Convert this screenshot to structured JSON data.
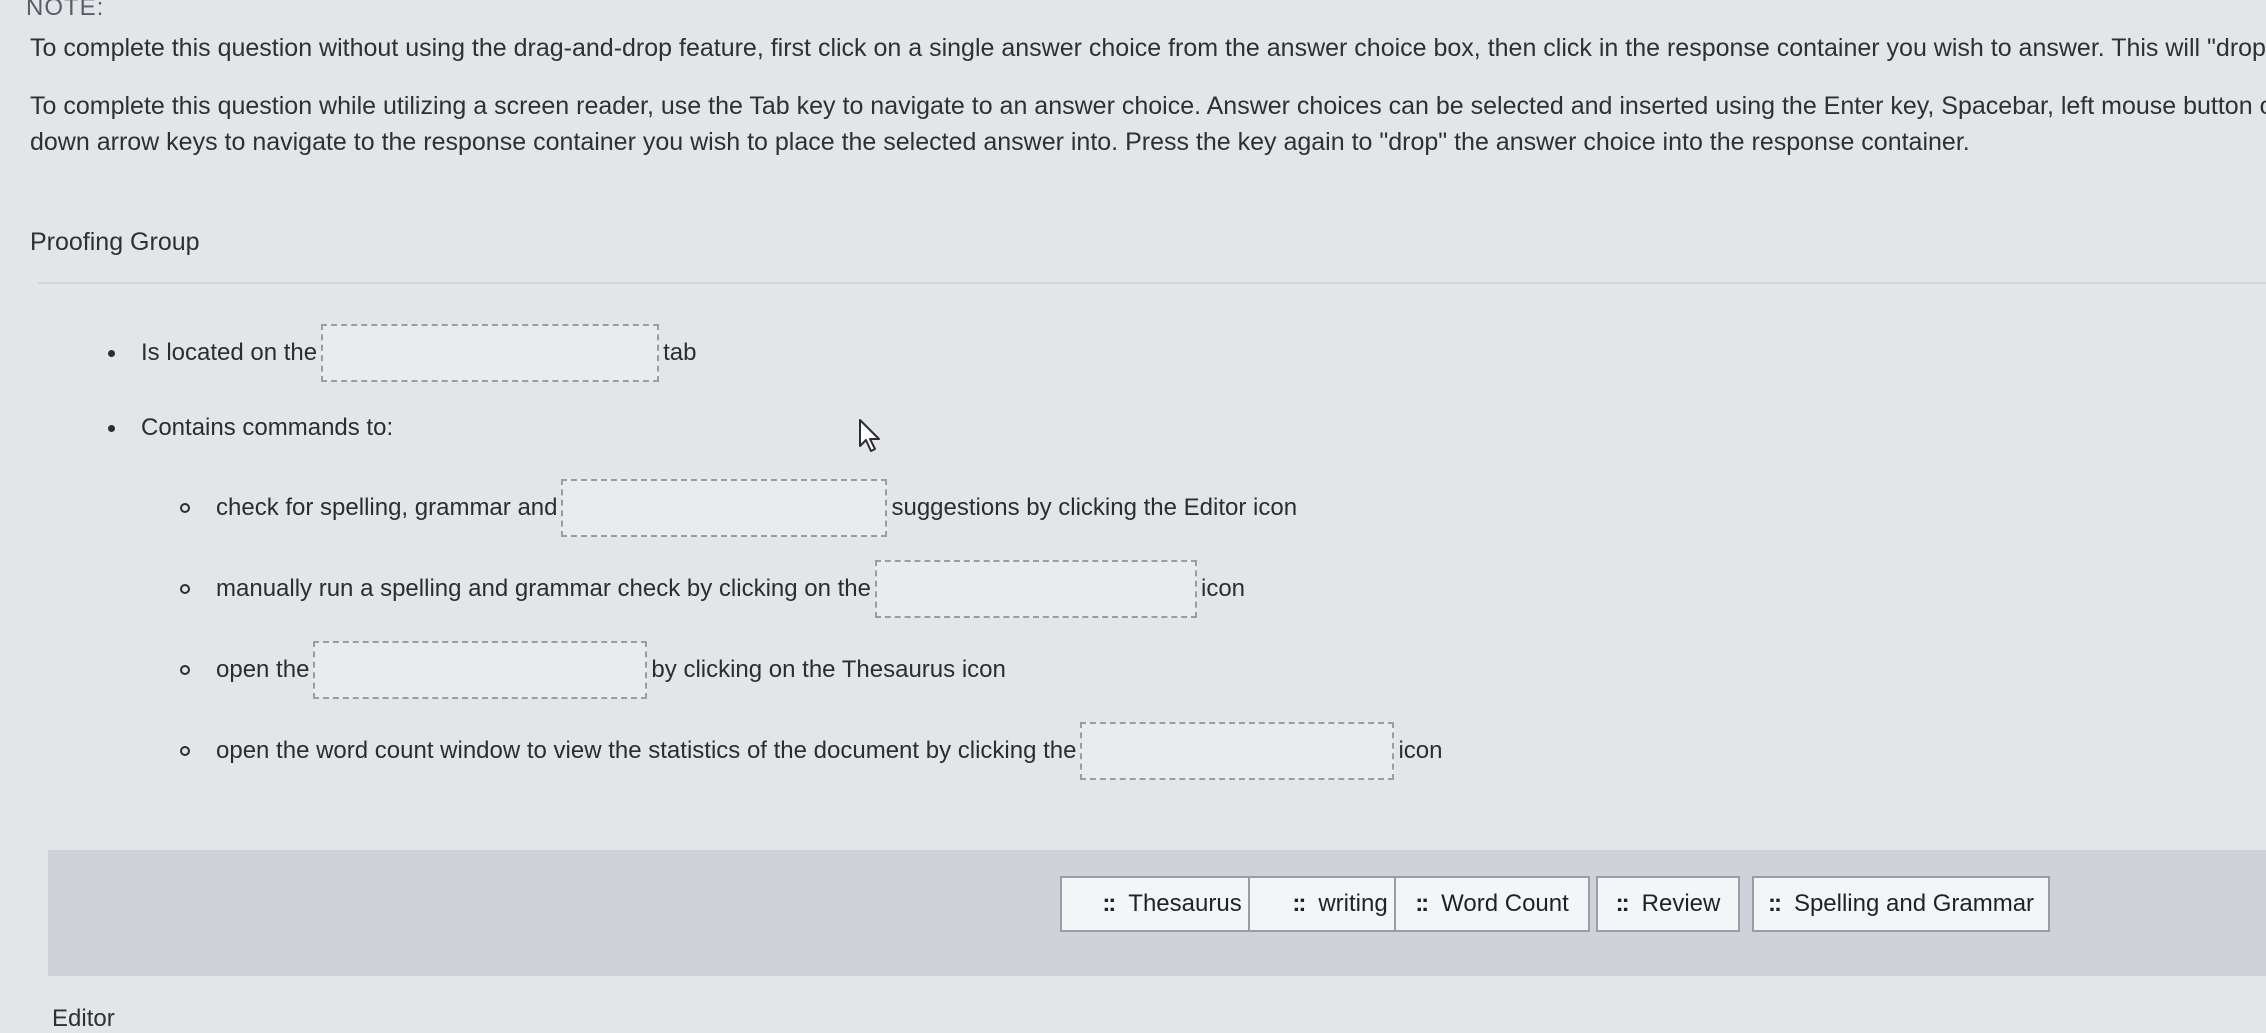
{
  "note": "NOTE:",
  "instructions": {
    "drag_drop_line": "To complete this question without using the drag-and-drop feature, first click on a single answer choice from the answer choice box, then click in the response container you wish to answer. This will \"drop\" the a",
    "screen_reader_line1": "To complete this question while utilizing a screen reader, use the Tab key to navigate to an answer choice. Answer choices can be selected and inserted using the Enter key, Spacebar, left mouse button or touch",
    "screen_reader_line2": "down arrow keys to navigate to the response container you wish to place the selected answer into. Press the key again to \"drop\" the answer choice into the response container."
  },
  "group_title": "Proofing Group",
  "items": {
    "located_prefix": "Is located on the",
    "located_suffix": "tab",
    "contains": "Contains commands to:",
    "check_prefix": "check for spelling, grammar and",
    "check_suffix": "suggestions by clicking the Editor icon",
    "manual_prefix": "manually run a spelling and grammar check by clicking on the",
    "manual_suffix": "icon",
    "open_prefix": "open the",
    "open_suffix": "by clicking on the Thesaurus icon",
    "wordcount_prefix": "open the word count window to view the statistics of the document by clicking the",
    "wordcount_suffix": "icon"
  },
  "choices": [
    {
      "label": "Thesaurus"
    },
    {
      "label": "writing"
    },
    {
      "label": "Word Count"
    },
    {
      "label": "Review"
    },
    {
      "label": "Spelling and Grammar"
    }
  ],
  "grip_glyph": "::",
  "bottom_label": "Editor"
}
